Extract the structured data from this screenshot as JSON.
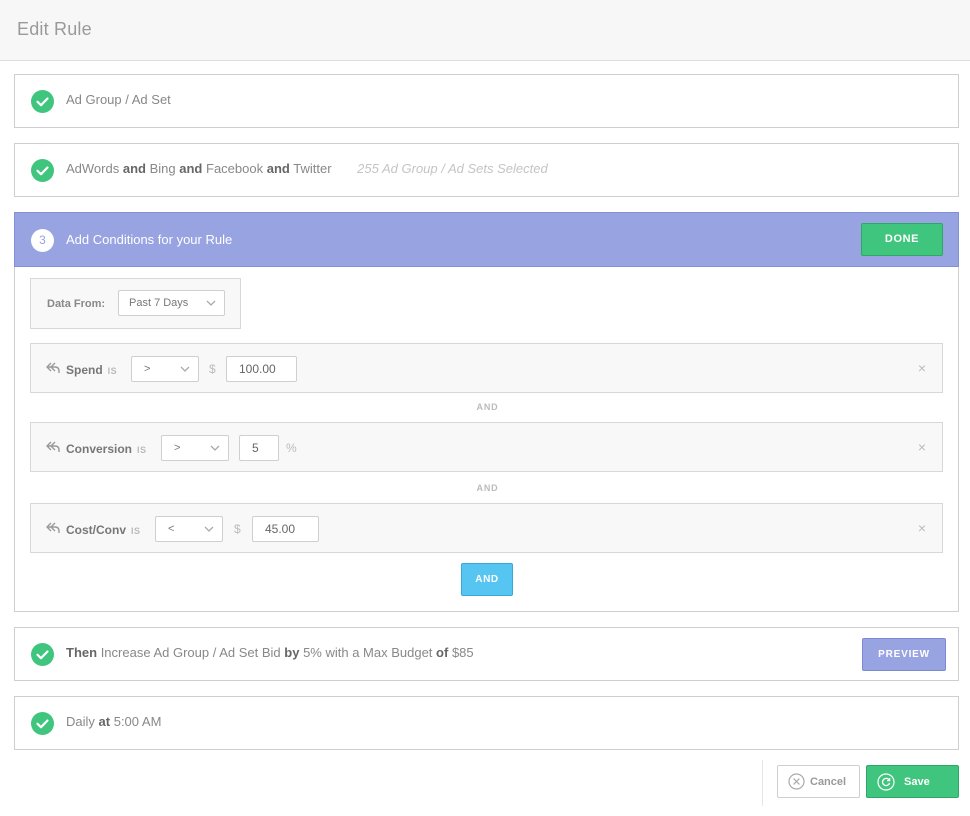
{
  "header": {
    "title": "Edit Rule"
  },
  "steps": {
    "ad_group": {
      "label": "Ad Group / Ad Set"
    },
    "networks": {
      "n1": "AdWords",
      "and1": "and",
      "n2": "Bing",
      "and2": "and",
      "n3": "Facebook",
      "and3": "and",
      "n4": "Twitter",
      "selected": "255 Ad Group / Ad Sets Selected"
    },
    "conditions": {
      "number": "3",
      "title": "Add Conditions for your Rule",
      "done_label": "DONE",
      "data_from": {
        "label": "Data From:",
        "value": "Past 7 Days"
      },
      "rows": [
        {
          "metric": "Spend",
          "is": "IS",
          "operator": ">",
          "prefix": "$",
          "value": "100.00",
          "suffix": ""
        },
        {
          "metric": "Conversion",
          "is": "IS",
          "operator": ">",
          "prefix": "",
          "value": "5",
          "suffix": "%"
        },
        {
          "metric": "Cost/Conv",
          "is": "IS",
          "operator": "<",
          "prefix": "$",
          "value": "45.00",
          "suffix": ""
        }
      ],
      "separator": "AND",
      "remove_glyph": "×",
      "add_and_label": "AND"
    },
    "action": {
      "then": "Then",
      "t1": "Increase Ad Group / Ad Set Bid",
      "by": "by",
      "t2": "5% with a Max Budget",
      "of": "of",
      "t3": "$85",
      "preview_label": "PREVIEW"
    },
    "schedule": {
      "t1": "Daily",
      "at": "at",
      "t2": "5:00 AM"
    }
  },
  "footer": {
    "cancel_label": "Cancel",
    "save_label": "Save"
  },
  "icons": {
    "check": "check-icon",
    "undo": "undo-icon",
    "chevron": "chevron-down-icon",
    "close": "close-icon",
    "cancel": "cancel-circle-icon",
    "save": "refresh-circle-icon"
  },
  "colors": {
    "success": "#3fc57d",
    "accent_purple": "#98a3e2",
    "accent_blue": "#56c5f2"
  }
}
